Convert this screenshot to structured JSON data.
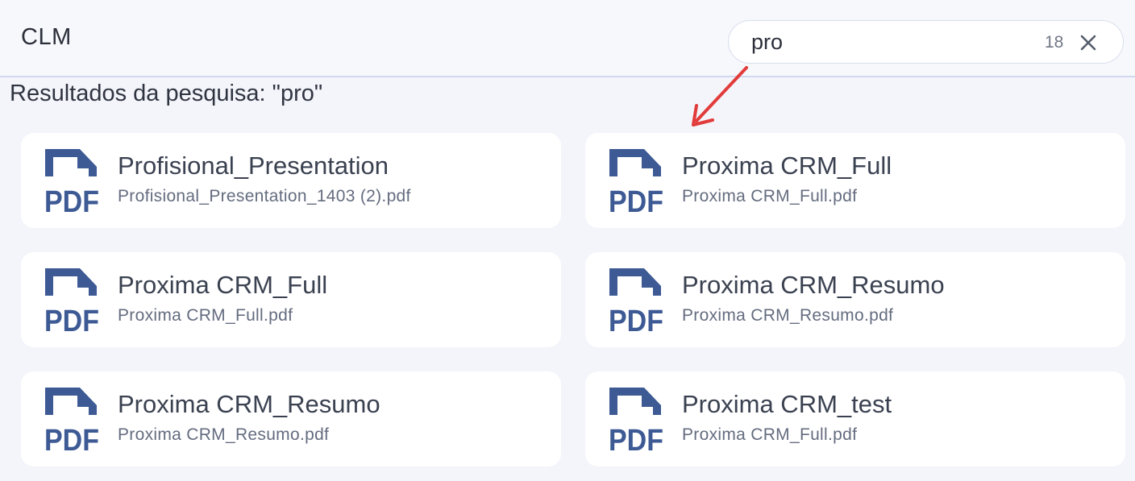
{
  "app": {
    "title": "CLM"
  },
  "search": {
    "value": "pro",
    "count": "18"
  },
  "results": {
    "heading": "Resultados da pesquisa: \"pro\"",
    "items": [
      {
        "title": "Profisional_Presentation",
        "file": "Profisional_Presentation_1403 (2).pdf",
        "icon": "pdf-file-icon"
      },
      {
        "title": "Proxima CRM_Full",
        "file": "Proxima CRM_Full.pdf",
        "icon": "pdf-file-icon"
      },
      {
        "title": "Proxima CRM_Full",
        "file": "Proxima CRM_Full.pdf",
        "icon": "pdf-file-icon"
      },
      {
        "title": "Proxima CRM_Resumo",
        "file": "Proxima CRM_Resumo.pdf",
        "icon": "pdf-file-icon"
      },
      {
        "title": "Proxima CRM_Resumo",
        "file": "Proxima CRM_Resumo.pdf",
        "icon": "pdf-file-icon"
      },
      {
        "title": "Proxima CRM_test",
        "file": "Proxima CRM_Full.pdf",
        "icon": "pdf-file-icon"
      }
    ]
  },
  "colors": {
    "pdf_icon": "#3d5a94",
    "annotation_arrow": "#e23b3b",
    "header_border": "#cfd8ee"
  },
  "icons": {
    "clear": "close-icon",
    "arrow": "annotation-arrow-icon"
  }
}
